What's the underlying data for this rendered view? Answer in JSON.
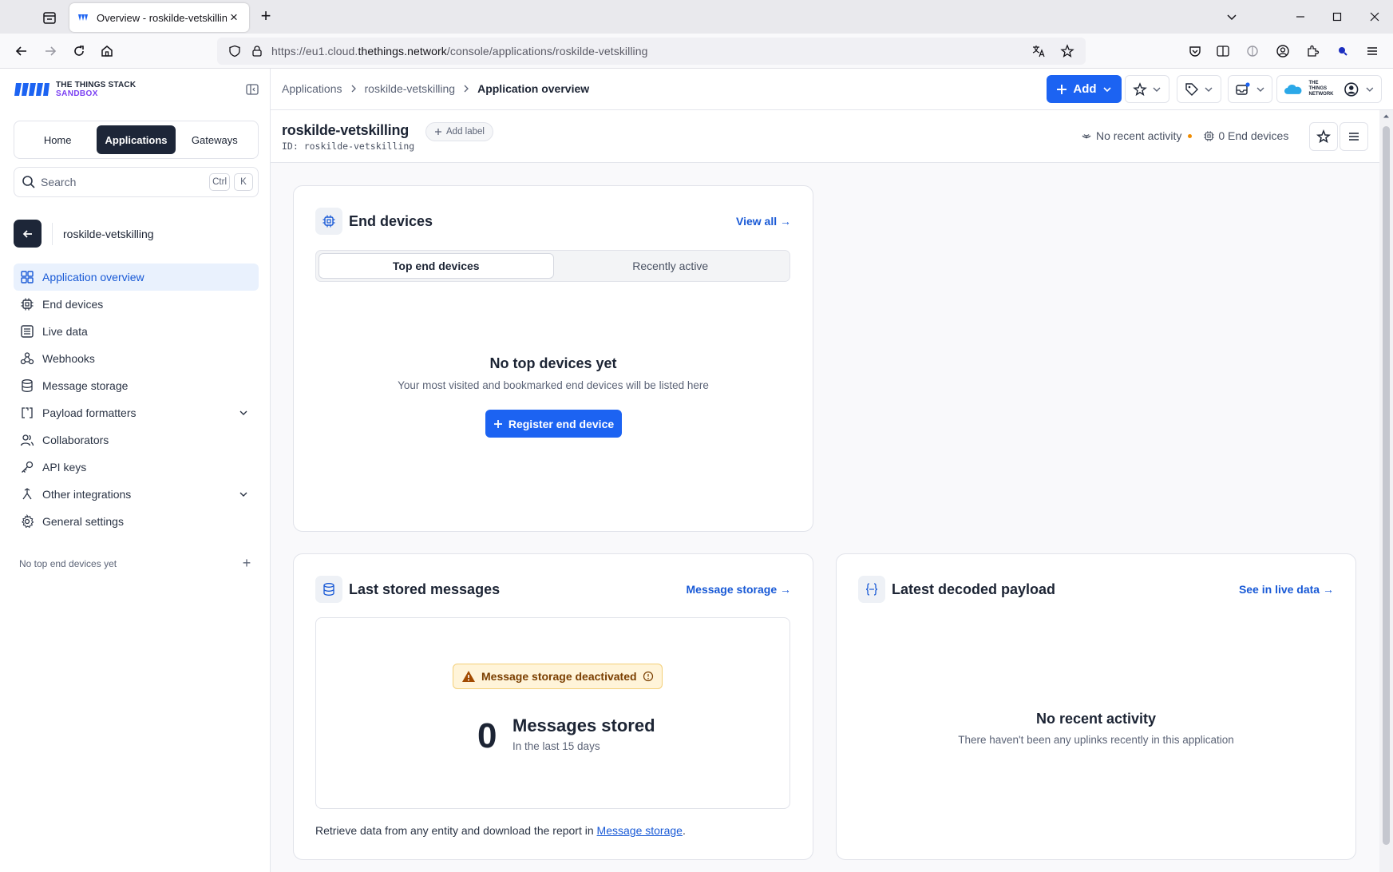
{
  "browser": {
    "tab_title": "Overview - roskilde-vetskilling · ",
    "url_prefix": "https://eu1.cloud.",
    "url_domain": "thethings.network",
    "url_path": "/console/applications/roskilde-vetskilling"
  },
  "brand": {
    "line1": "THE THINGS STACK",
    "line2": "SANDBOX"
  },
  "sidebar": {
    "switcher": [
      "Home",
      "Applications",
      "Gateways"
    ],
    "search_placeholder": "Search",
    "search_keys": [
      "Ctrl",
      "K"
    ],
    "app_name": "roskilde-vetskilling",
    "items": [
      {
        "label": "Application overview",
        "icon": "grid-icon"
      },
      {
        "label": "End devices",
        "icon": "chip-icon"
      },
      {
        "label": "Live data",
        "icon": "list-icon"
      },
      {
        "label": "Webhooks",
        "icon": "webhook-icon"
      },
      {
        "label": "Message storage",
        "icon": "database-icon"
      },
      {
        "label": "Payload formatters",
        "icon": "code-icon"
      },
      {
        "label": "Collaborators",
        "icon": "users-icon"
      },
      {
        "label": "API keys",
        "icon": "key-icon"
      },
      {
        "label": "Other integrations",
        "icon": "integration-icon"
      },
      {
        "label": "General settings",
        "icon": "gear-icon"
      }
    ],
    "footer_text": "No top end devices yet",
    "footer_plus": "+"
  },
  "topbar": {
    "crumbs": [
      "Applications",
      "roskilde-vetskilling",
      "Application overview"
    ],
    "add_label": "Add",
    "network_text": "THE THINGS NETWORK"
  },
  "page": {
    "title": "roskilde-vetskilling",
    "id_text": "ID: roskilde-vetskilling",
    "add_label": "Add label",
    "activity": "No recent activity",
    "end_devices": "0 End devices"
  },
  "end_devices_card": {
    "title": "End devices",
    "link": "View all →",
    "tabs": [
      "Top end devices",
      "Recently active"
    ],
    "empty_title": "No top devices yet",
    "empty_sub": "Your most visited and bookmarked end devices will be listed here",
    "register_label": "Register end device"
  },
  "stored_card": {
    "title": "Last stored messages",
    "link": "Message storage →",
    "warning": "Message storage deactivated",
    "count": "0",
    "count_label": "Messages stored",
    "count_sub": "In the last 15 days",
    "retrieve_text": "Retrieve data from any entity and download the report in ",
    "retrieve_link": "Message storage",
    "retrieve_end": "."
  },
  "payload_card": {
    "title": "Latest decoded payload",
    "link": "See in live data →",
    "empty_title": "No recent activity",
    "empty_sub": "There haven't been any uplinks recently in this application"
  },
  "colors": {
    "primary": "#1c63f2",
    "dark": "#1d2638",
    "active_bg": "#e9f1fd",
    "warning_bg": "#fff4d9",
    "status_dot": "#f08c00"
  }
}
